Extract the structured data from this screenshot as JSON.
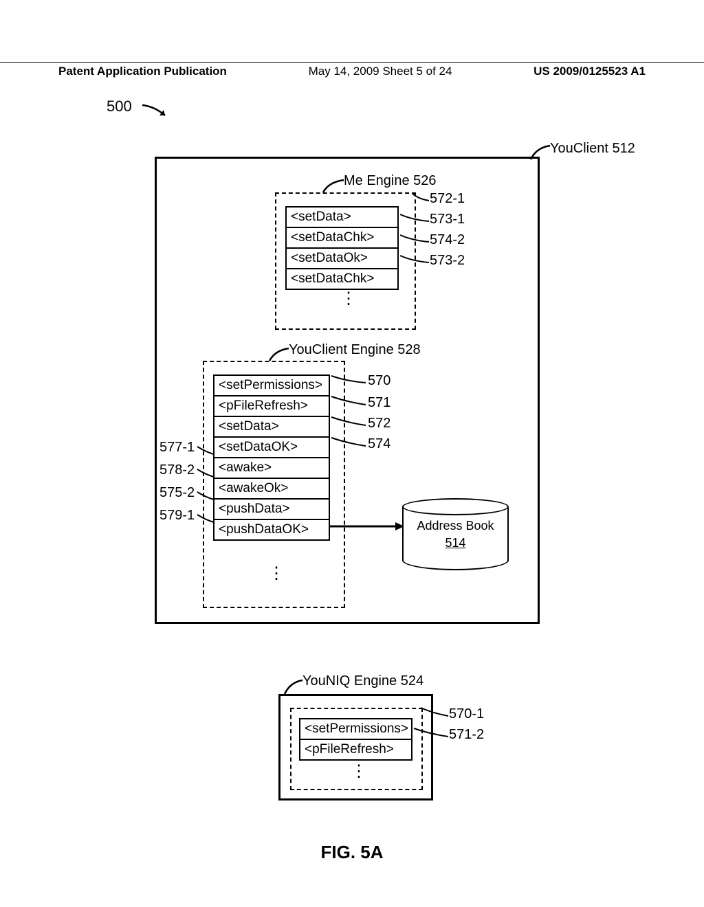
{
  "header": {
    "left": "Patent Application Publication",
    "center": "May 14, 2009  Sheet 5 of 24",
    "right": "US 2009/0125523 A1"
  },
  "ref500": "500",
  "youclient512": "YouClient 512",
  "meEngine": {
    "label": "Me Engine 526",
    "rows": [
      "<setData>",
      "<setDataChk>",
      "<setDataOk>",
      "<setDataChk>"
    ],
    "rightRefs": [
      "572-1",
      "573-1",
      "574-2",
      "573-2"
    ]
  },
  "ycEngine": {
    "label": "YouClient Engine 528",
    "rows": [
      "<setPermissions>",
      "<pFileRefresh>",
      "<setData>",
      "<setDataOK>",
      "<awake>",
      "<awakeOk>",
      "<pushData>",
      "<pushDataOK>"
    ],
    "rightRefs": [
      "570",
      "571",
      "572",
      "574"
    ],
    "leftRefs": [
      "577-1",
      "578-2",
      "575-2",
      "579-1"
    ]
  },
  "addressBook": {
    "label": "Address Book",
    "num": "514"
  },
  "youniq": {
    "label": "YouNIQ Engine 524",
    "rows": [
      "<setPermissions>",
      "<pFileRefresh>"
    ],
    "rightRefs": [
      "570-1",
      "571-2"
    ]
  },
  "figure": "FIG. 5A"
}
